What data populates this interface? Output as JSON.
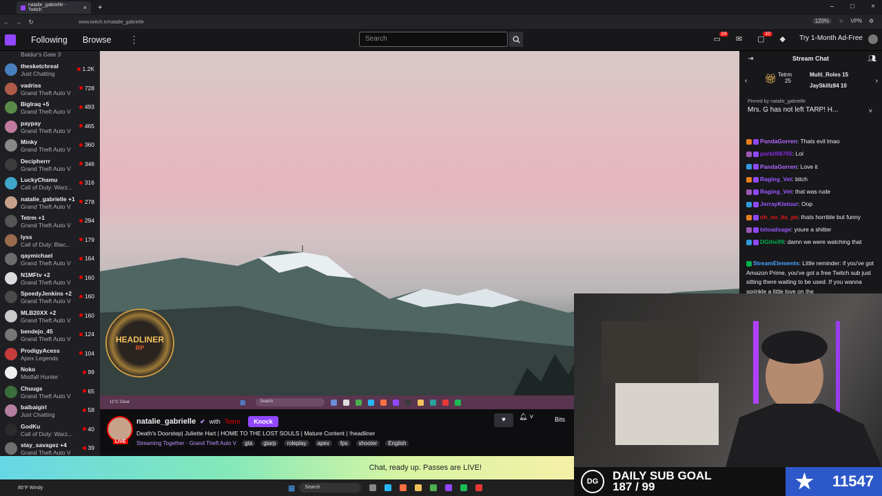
{
  "browser": {
    "tab_title": "natalie_gabrielle - Twitch",
    "url": "www.twitch.tv/natalie_gabrielle",
    "zoom": "120%",
    "vpn": "VPN"
  },
  "nav": {
    "following": "Following",
    "browse": "Browse",
    "search_placeholder": "Search",
    "notif_count": "24",
    "whisper_count": "10",
    "ad_free": "Try 1-Month Ad-Free"
  },
  "sidebar": [
    {
      "name": "",
      "game": "Baldur's Gate 3",
      "viewers": "",
      "color": "#6a5acd"
    },
    {
      "name": "thesketchreal",
      "game": "Just Chatting",
      "viewers": "1.2K",
      "color": "#4a7fbf"
    },
    {
      "name": "vadriss",
      "game": "Grand Theft Auto V",
      "viewers": "728",
      "color": "#b05a4a"
    },
    {
      "name": "Biglraq +5",
      "game": "Grand Theft Auto V",
      "viewers": "493",
      "color": "#5a8a4a"
    },
    {
      "name": "paypay",
      "game": "Grand Theft Auto V",
      "viewers": "465",
      "color": "#c27ba0"
    },
    {
      "name": "Minky",
      "game": "Grand Theft Auto V",
      "viewers": "360",
      "color": "#888"
    },
    {
      "name": "Decipherrr",
      "game": "Grand Theft Auto V",
      "viewers": "346",
      "color": "#3c3c3c"
    },
    {
      "name": "LuckyChamu",
      "game": "Call of Duty: Warz...",
      "viewers": "316",
      "color": "#3fa7c9"
    },
    {
      "name": "natalie_gabrielle +1",
      "game": "Grand Theft Auto V",
      "viewers": "278",
      "color": "#c7a28a"
    },
    {
      "name": "Tetrm +1",
      "game": "Grand Theft Auto V",
      "viewers": "294",
      "color": "#555"
    },
    {
      "name": "lyss",
      "game": "Call of Duty: Blac...",
      "viewers": "179",
      "color": "#9a6b4f"
    },
    {
      "name": "qaymichael",
      "game": "Grand Theft Auto V",
      "viewers": "164",
      "color": "#6b6b6b"
    },
    {
      "name": "N1MFtv +2",
      "game": "Grand Theft Auto V",
      "viewers": "160",
      "color": "#ddd"
    },
    {
      "name": "SpeedyJenkins +2",
      "game": "Grand Theft Auto V",
      "viewers": "160",
      "color": "#4a4a4a"
    },
    {
      "name": "MLB20XX +2",
      "game": "Grand Theft Auto V",
      "viewers": "160",
      "color": "#c9c9c9"
    },
    {
      "name": "bendejo_45",
      "game": "Grand Theft Auto V",
      "viewers": "124",
      "color": "#777"
    },
    {
      "name": "ProdigyAcess",
      "game": "Apex Legends",
      "viewers": "104",
      "color": "#c63c3c"
    },
    {
      "name": "Noko",
      "game": "Mistfall Hunter",
      "viewers": "99",
      "color": "#eee"
    },
    {
      "name": "Chuugs",
      "game": "Grand Theft Auto V",
      "viewers": "65",
      "color": "#3c6e3c"
    },
    {
      "name": "baibaigirl",
      "game": "Just Chatting",
      "viewers": "58",
      "color": "#b37ea0"
    },
    {
      "name": "GodKu",
      "game": "Call of Duty: Warz...",
      "viewers": "40",
      "color": "#2b2b2b"
    },
    {
      "name": "stay_savagez +4",
      "game": "Grand Theft Auto V",
      "viewers": "39",
      "color": "#6f6f6f"
    }
  ],
  "stream": {
    "overlay_logo_top": "HEADLINER",
    "overlay_logo_bottom": "RP",
    "tb_weather": "11°C Clear",
    "tb_search": "Search",
    "channel": "natalie_gabrielle",
    "with": "with",
    "collab": "Tetrm",
    "knock": "Knock",
    "live": "LIVE",
    "title": "Death's Doorstep| Juliette Hart | HOME TO THE LOST SOULS | Mature Content | !headliner",
    "streaming_together": "Streaming Together · Grand Theft Auto V",
    "tags": [
      "gta",
      "gtarp",
      "roleplay",
      "apex",
      "fps",
      "shooter",
      "English"
    ],
    "bits": "Bits"
  },
  "banner": {
    "text": "Chat, ready up. Passes are LIVE!"
  },
  "chat": {
    "header": "Stream Chat",
    "gift_top": "Tetrm",
    "gift_top_count": "25",
    "gift_users": [
      "Multi_Roles 15",
      "JaySkillz84 10"
    ],
    "pinned_label": "Pinned by natalie_gabrielle",
    "pinned_text": "Mrs. G has not left TARP! H...",
    "messages": [
      {
        "user": "PandaGorren",
        "color": "#b168ff",
        "text": "Thats evil lmao"
      },
      {
        "user": "pork098765",
        "color": "#8a2be2",
        "text": "Lol"
      },
      {
        "user": "PandaGorren",
        "color": "#b168ff",
        "text": "Love it"
      },
      {
        "user": "Raging_Vet",
        "color": "#9b59ff",
        "text": "bitch"
      },
      {
        "user": "Raging_Vet",
        "color": "#9b59ff",
        "text": "that was rude"
      },
      {
        "user": "JerrayKletour",
        "color": "#9b59ff",
        "text": "Oop"
      },
      {
        "user": "oh_no_its_pe",
        "color": "#e91916",
        "text": "thats horrible but funny"
      },
      {
        "user": "txtoadsage",
        "color": "#9b59ff",
        "text": "youre a shitter"
      },
      {
        "user": "DGthe99",
        "color": "#00b04f",
        "text": "damn we were watching that"
      }
    ],
    "se_user": "StreamElements",
    "se_text": "Little reminder: if you've got Amazon Prime, you've got a free Twitch sub just sitting there waiting to be used. If you wanna sprinkle a little love on the"
  },
  "goal": {
    "logo": "DG",
    "title": "DAILY SUB GOAL",
    "progress": "187 / 99",
    "count": "11547"
  },
  "taskbar": {
    "weather": "85°F Windy",
    "search": "Search"
  }
}
